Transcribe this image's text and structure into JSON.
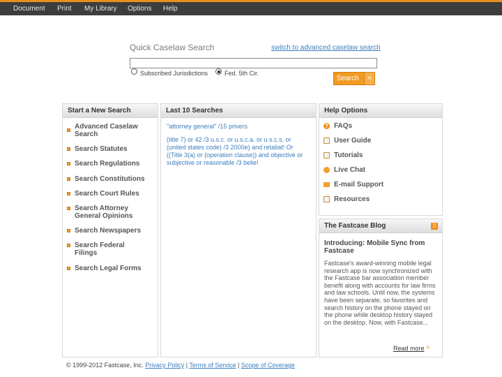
{
  "menu": [
    "Document",
    "Print",
    "My Library",
    "Options",
    "Help"
  ],
  "quick_search": {
    "title": "Quick Caselaw Search",
    "advanced_link": "switch to advanced caselaw search",
    "input_value": "",
    "options": [
      "Subscribed Jurisdictions",
      "Fed. 5th Cir."
    ],
    "selected_option": "Fed. 5th Cir.",
    "button_label": "Search",
    "button_arrow": "»"
  },
  "start_panel": {
    "title": "Start a New Search",
    "items": [
      "Advanced Caselaw Search",
      "Search Statutes",
      "Search Regulations",
      "Search Constitutions",
      "Search Court Rules",
      "Search Attorney General Opinions",
      "Search Newspapers",
      "Search Federal Filings",
      "Search Legal Forms"
    ]
  },
  "last_panel": {
    "title": "Last 10 Searches",
    "items": [
      "\"attorney general\" /15 privers",
      "(title 7) or 42 /3 u.s.c. or u.s.c.a. or u.s.c.s. or (united states code) /3 2000e) and retaliat! Or ((Title 3(a) or (operation clause)) and objective or subjective or reasonable /3 belie!"
    ]
  },
  "help_panel": {
    "title": "Help Options",
    "items": [
      {
        "label": "FAQs",
        "icon": "question-icon"
      },
      {
        "label": "User Guide",
        "icon": "document-icon"
      },
      {
        "label": "Tutorials",
        "icon": "document-icon"
      },
      {
        "label": "Live Chat",
        "icon": "chat-icon"
      },
      {
        "label": "E-mail Support",
        "icon": "email-icon"
      },
      {
        "label": "Resources",
        "icon": "document-icon"
      }
    ]
  },
  "blog_panel": {
    "title": "The Fastcase Blog",
    "post_title": "Introducing: Mobile Sync from Fastcase",
    "post_text": "Fastcase's award-winning mobile legal research app is now synchronized with the Fastcase bar association member benefit along with accounts for law firms and law schools. Until now, the systems have been separate, so favorites and search history on the phone stayed on the phone while desktop history stayed on the desktop. Now, with Fastcase...",
    "read_more": "Read more",
    "read_more_arrow": "»"
  },
  "footer": {
    "copyright": "© 1999-2012 Fastcase, Inc.",
    "links": [
      "Privacy Policy",
      "Terms of Service",
      "Scope of Coverage"
    ]
  },
  "colors": {
    "accent": "#e8901e",
    "link": "#3a7dbd",
    "topbar": "#3d3d3d"
  }
}
